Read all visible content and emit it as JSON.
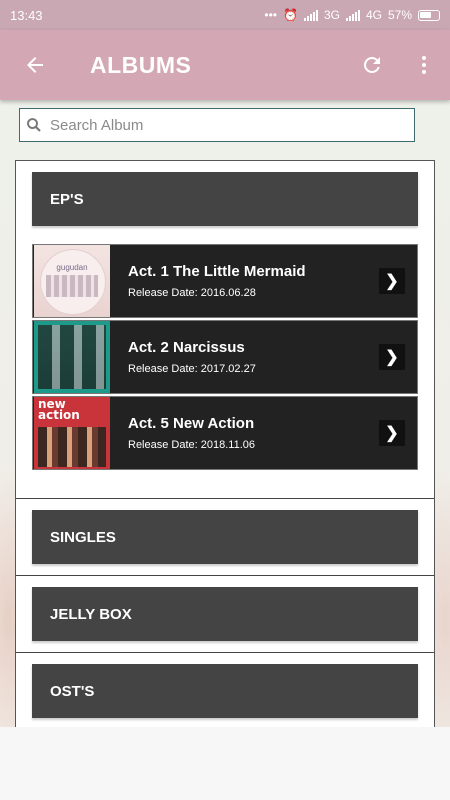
{
  "status_bar": {
    "time": "13:43",
    "network_1": "3G",
    "network_2": "4G",
    "battery": "57%"
  },
  "toolbar": {
    "title": "ALBUMS"
  },
  "search": {
    "placeholder": "Search Album"
  },
  "sections": [
    {
      "label": "EP'S"
    },
    {
      "label": "SINGLES"
    },
    {
      "label": "JELLY BOX"
    },
    {
      "label": "OST'S"
    }
  ],
  "albums": [
    {
      "name": "Act. 1 The Little Mermaid",
      "date": "Release Date: 2016.06.28",
      "cover_text": "gugudan"
    },
    {
      "name": "Act. 2 Narcissus",
      "date": "Release Date: 2017.02.27",
      "cover_text": ""
    },
    {
      "name": "Act. 5 New Action",
      "date": "Release Date: 2018.11.06",
      "cover_text": "new action"
    }
  ]
}
